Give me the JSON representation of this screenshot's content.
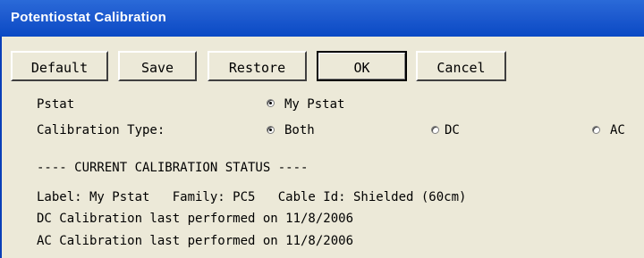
{
  "window": {
    "title": "Potentiostat Calibration"
  },
  "buttons": {
    "default": "Default",
    "save": "Save",
    "restore": "Restore",
    "ok": "OK",
    "cancel": "Cancel"
  },
  "pstat": {
    "label": "Pstat",
    "options": [
      {
        "text": "My Pstat",
        "checked": true
      }
    ]
  },
  "calibration_type": {
    "label": "Calibration Type:",
    "options": [
      {
        "text": "Both",
        "checked": true
      },
      {
        "text": "DC",
        "checked": false
      },
      {
        "text": "AC",
        "checked": false
      }
    ]
  },
  "status": {
    "header": "---- CURRENT CALIBRATION STATUS ----",
    "label_line": "Label: My Pstat   Family: PC5   Cable Id: Shielded (60cm)",
    "dc_line": "DC Calibration last performed on 11/8/2006",
    "ac_line": "AC Calibration last performed on 11/8/2006"
  }
}
